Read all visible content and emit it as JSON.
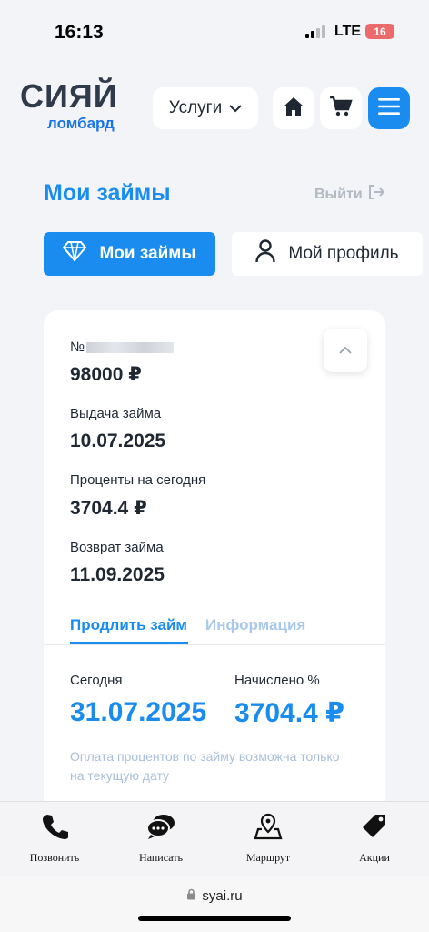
{
  "status": {
    "time": "16:13",
    "network": "LTE",
    "battery": "16"
  },
  "header": {
    "brand": "СИЯЙ",
    "brand_sub": "ломбард",
    "services_label": "Услуги"
  },
  "page": {
    "title": "Мои займы",
    "logout": "Выйти"
  },
  "tabs": {
    "loans": "Мои займы",
    "profile": "Мой профиль"
  },
  "loan": {
    "number_label": "№",
    "amount": "98000 ₽",
    "issue_label": "Выдача займа",
    "issue_date": "10.07.2025",
    "interest_label": "Проценты на сегодня",
    "interest_value": "3704.4 ₽",
    "return_label": "Возврат займа",
    "return_date": "11.09.2025"
  },
  "loan_tabs": {
    "extend": "Продлить займ",
    "info": "Информация"
  },
  "extend": {
    "today_label": "Сегодня",
    "today_value": "31.07.2025",
    "accrued_label": "Начислено %",
    "accrued_value": "3704.4 ₽",
    "note": "Оплата процентов по займу возможна только на текущую дату"
  },
  "bottom_nav": [
    {
      "label": "Позвонить",
      "icon": "phone-icon"
    },
    {
      "label": "Написать",
      "icon": "chat-icon"
    },
    {
      "label": "Маршрут",
      "icon": "map-route-icon"
    },
    {
      "label": "Акции",
      "icon": "tag-icon"
    }
  ],
  "browser": {
    "url": "syai.ru"
  },
  "colors": {
    "accent": "#1a8cf0",
    "text": "#1f2733",
    "muted": "#b3b9c2"
  }
}
